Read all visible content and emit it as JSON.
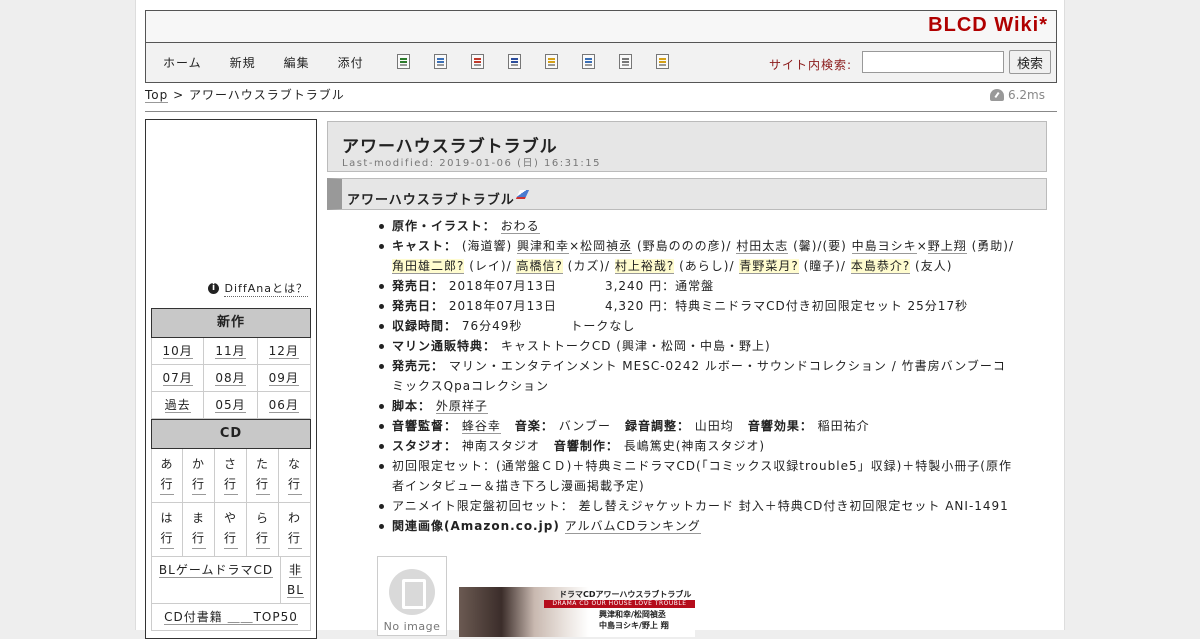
{
  "header": {
    "site_title": "BLCD Wiki*"
  },
  "nav": {
    "links": [
      "ホーム",
      "新規",
      "編集",
      "添付"
    ],
    "tool_icons": [
      "copy-icon",
      "rename-icon",
      "diff-icon",
      "backup-icon",
      "freeze-icon",
      "list-icon",
      "recent-icon",
      "help-icon"
    ],
    "search_label": "サイト内検索:",
    "search_value": "",
    "search_button": "検索"
  },
  "breadcrumb": {
    "top": "Top",
    "sep": ">",
    "current": "アワーハウスラブトラブル"
  },
  "timing": "6.2ms",
  "sidebar": {
    "diff_link": "DiffAnaとは？",
    "new_heading": "新作",
    "new_items": [
      "10月",
      "11月",
      "12月",
      "07月",
      "08月",
      "09月",
      "過去",
      "05月",
      "06月"
    ],
    "cd_heading": "CD",
    "kana_items": [
      "あ行",
      "か行",
      "さ行",
      "た行",
      "な行",
      "は行",
      "ま行",
      "や行",
      "ら行",
      "わ行"
    ],
    "row1_left": "BLゲームドラマCD",
    "row1_right": "非BL",
    "row2": "CD付書籍 ＿＿TOP50"
  },
  "main": {
    "title": "アワーハウスラブトラブル",
    "last_modified": "Last-modified: 2019-01-06 (日) 16:31:15",
    "h2": "アワーハウスラブトラブル",
    "gensaku_label": "原作・イラスト：",
    "gensaku_link": "おわる",
    "cast_label": "キャスト：",
    "cast_1": "(海道響)",
    "cast_2": "興津和幸",
    "cast_3": "×",
    "cast_4": "松岡禎丞",
    "cast_5": "(野島ののの彦)/",
    "cast_6": "村田太志",
    "cast_7": "(馨)/(要)",
    "cast_8": "中島ヨシキ",
    "cast_9": "×",
    "cast_10": "野上翔",
    "cast_11": "(勇助)/",
    "cast_12": "角田雄二郎?",
    "cast_13": "(レイ)/",
    "cast_14": "高橋信?",
    "cast_15": "(カズ)/",
    "cast_16": "村上裕哉?",
    "cast_17": "(あらし)/",
    "cast_18": "青野菜月?",
    "cast_19": "(瞳子)/",
    "cast_20": "本島恭介?",
    "cast_21": "(友人)",
    "release1_label": "発売日：",
    "release1_date": "2018年07月13日",
    "release1_price": "3,240 円：通常盤",
    "release2_label": "発売日：",
    "release2_date": "2018年07月13日",
    "release2_price": "4,320 円：特典ミニドラマCD付き初回限定セット 25分17秒",
    "rectime_label": "収録時間：",
    "rectime_value": "76分49秒",
    "rectime_note": "トークなし",
    "marine_label": "マリン通販特典：",
    "marine_value": "キャストトークCD (興津・松岡・中島・野上)",
    "seller_label": "発売元：",
    "seller_value": "マリン・エンタテインメント MESC-0242 ルボー・サウンドコレクション / 竹書房バンブーコミックスQpaコレクション",
    "script_label": "脚本：",
    "script_link": "外原祥子",
    "sound_label": "音響監督：",
    "sound_link": "蜂谷幸",
    "music_label": "音楽：",
    "music_value": "バンブー",
    "rec_label": "録音調整：",
    "rec_value": "山田均",
    "effect_label": "音響効果：",
    "effect_value": "稲田祐介",
    "studio_label": "スタジオ：",
    "studio_value": "神南スタジオ",
    "prod_label": "音響制作：",
    "prod_value": "長嶋篤史(神南スタジオ)",
    "limited": "初回限定セット：(通常盤ＣＤ)＋特典ミニドラマCD(「コミックス収録trouble5」収録)＋特製小冊子(原作者インタビュー＆描き下ろし漫画掲載予定)",
    "animate": "アニメイト限定盤初回セット： 差し替えジャケットカード 封入＋特典CD付き初回限定セット ANI-1491",
    "related_label": "関連画像(Amazon.co.jp)",
    "related_link": "アルバムCDランキング",
    "noimage": "No image",
    "cover_title": "ドラマCDアワーハウスラブトラブル",
    "cover_band": "DRAMA CD OUR HOUSE LOVE TROUBLE",
    "cover_cast1": "興津和幸/松岡禎丞",
    "cover_cast2": "中島ヨシキ/野上 翔"
  }
}
